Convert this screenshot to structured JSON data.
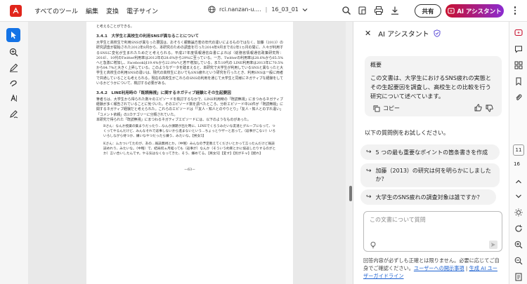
{
  "topbar": {
    "menu": [
      "すべてのツール",
      "編集",
      "変換",
      "電子サイン"
    ],
    "filename": "rci.nanzan-u....",
    "page_id": "16_03_01",
    "share_label": "共有",
    "ai_label": "AI アシスタント"
  },
  "document": {
    "top_line": "と考えることができる。",
    "h1": "3.4.1　大学生と高校生の利用SNSが異なることについて",
    "p1": "大学生と高校生で利用SNSが異なった要因は、おそらく銀籍論方若の年代の違いによるものではなく、加藤（2013）の研究調査が開始された2012年8月から、本研究のための調査を行った2014年9月までの2年1ヵ月の間に、人々が利用するSNSに変化が生まれたためだと考えられる。平成27年度情報通信白書によれば（総務省情報通信政策研究所：2016）、10代のTwitter利用率は2012年の28.6%から29%に至っている。一方、Twitterの利用率は28.6%から65.5%へと急激に増加し、Facebookは19.4%から22.0%へと若干増加している。また10代の LINE利用率は2013年に70.5%から84.7%と大きく上昇している。このようなデータを踏まえると、本研究で大学生が利用しているSNSと異なったと大学生と高校生の利用SNSの違いは、現代の高校生においてもSNS疲れという研究を行ったとき、利用SNSは一般に両者で共通していることも考えられる。現在の高校生がこれらのSNSの利用を通じて大学生と同様にネガティブな経験をしているかどうかについて、検討する必要がある。",
    "h2": "3.4.2　LINE利用時の「既読無視」に関するネガティブ経験とその生起要因",
    "p2a": "筆者らは、大学生から得られた数々のエピソードを検討するなかで、LINE利用時の「既読無視」にまつわるネガティブ経験が多く報告されていることに気づいた。そのエピソード数を調べたところ、分析エピソード中26件が「既読無視」に関するネガティブ経験だと考えられた。これらのエピソードは「「友人・知人とのやりとり」「友人・知人とのすれ違い」「コメント依頼」の3カテゴリーに分類されていた。",
    "p2b": "本研究で得られた「既読無視」にまつわるネガティブエピソードには、以下のようなものがあった。",
    "q1": "Bさん：なんか授業の集まりだったり…なんか課題が出た時に、LINEでくろうみたいな友達とグループになって、つくってやるんだけど、みんなそれで返事しないから進まないという…ちょっとウザーと思って。（返事がこない）いろいろしながら待つか、嫌いなやつだったら嫌う、みたいな。【男女5】",
    "q2": "Kさん：ムカついてたのが、あの…既読無視とか。（中略）みんなの予定教えてくださいとかって言ったんだけど既読読めれり、みたいな。（中略）で、結局何ヵ月経っても（返事が）なんか（そういう約束とかに協返したりするのがとか）言い合いしたんです。やる気はなくなってきた、そう、嫌めてる。【男女5】【変す】【別がチャ】【揺れ】",
    "page_number": "－63－"
  },
  "assistant": {
    "title": "AI アシスタント",
    "summary_title": "概要",
    "summary_body": "この文書は、大学生におけるSNS疲れの実態とその生起要因を調査し、高校生との比較を行う研究について述べています。",
    "copy_label": "コピー",
    "prompt_label": "以下の質問例をお試しください。",
    "suggestions": [
      "5 つの最も重要なポイントの箇条書きを作成",
      "加藤（2013）の研究は何を明らかにしましたか？",
      "大学生のSNS疲れの調査対象は誰ですか？"
    ],
    "input_placeholder": "この文書について質問",
    "disclaimer": "回答内容が必ずしも正確とは限りません。必要に応じてご自身でご確認ください。",
    "link1": "ユーザーへの開示事項",
    "link_sep": " | ",
    "link2": "生成 AI ユーザーガイドライン"
  },
  "pager": {
    "current": "11",
    "total": "16"
  }
}
